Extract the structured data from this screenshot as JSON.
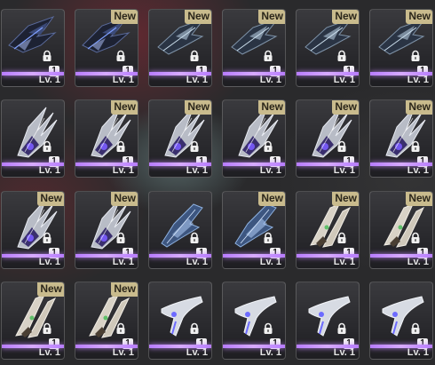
{
  "inventory": {
    "items": [
      {
        "level": "Lv. 1",
        "quantity": "1",
        "is_new": false,
        "new_label": "",
        "icon": "dark-blade-fighter-icon"
      },
      {
        "level": "Lv. 1",
        "quantity": "1",
        "is_new": true,
        "new_label": "New",
        "icon": "dark-blade-fighter-icon"
      },
      {
        "level": "Lv. 1",
        "quantity": "1",
        "is_new": true,
        "new_label": "New",
        "icon": "spike-fighter-icon"
      },
      {
        "level": "Lv. 1",
        "quantity": "1",
        "is_new": true,
        "new_label": "New",
        "icon": "spike-fighter-icon"
      },
      {
        "level": "Lv. 1",
        "quantity": "1",
        "is_new": true,
        "new_label": "New",
        "icon": "spike-fighter-icon"
      },
      {
        "level": "Lv. 1",
        "quantity": "1",
        "is_new": true,
        "new_label": "New",
        "icon": "spike-fighter-icon"
      },
      {
        "level": "Lv. 1",
        "quantity": "1",
        "is_new": false,
        "new_label": "",
        "icon": "silver-fork-fighter-icon"
      },
      {
        "level": "Lv. 1",
        "quantity": "1",
        "is_new": true,
        "new_label": "New",
        "icon": "silver-fork-fighter-icon"
      },
      {
        "level": "Lv. 1",
        "quantity": "1",
        "is_new": true,
        "new_label": "New",
        "icon": "silver-fork-fighter-icon"
      },
      {
        "level": "Lv. 1",
        "quantity": "1",
        "is_new": true,
        "new_label": "New",
        "icon": "silver-fork-fighter-icon"
      },
      {
        "level": "Lv. 1",
        "quantity": "1",
        "is_new": true,
        "new_label": "New",
        "icon": "silver-fork-fighter-icon"
      },
      {
        "level": "Lv. 1",
        "quantity": "1",
        "is_new": true,
        "new_label": "New",
        "icon": "silver-fork-fighter-icon"
      },
      {
        "level": "Lv. 1",
        "quantity": "1",
        "is_new": true,
        "new_label": "New",
        "icon": "silver-fork-fighter-icon"
      },
      {
        "level": "Lv. 1",
        "quantity": "1",
        "is_new": true,
        "new_label": "New",
        "icon": "silver-fork-fighter-icon"
      },
      {
        "level": "Lv. 1",
        "quantity": "1",
        "is_new": false,
        "new_label": "",
        "icon": "blue-wing-fighter-icon"
      },
      {
        "level": "Lv. 1",
        "quantity": "1",
        "is_new": true,
        "new_label": "New",
        "icon": "blue-wing-fighter-icon"
      },
      {
        "level": "Lv. 1",
        "quantity": "1",
        "is_new": true,
        "new_label": "New",
        "icon": "twin-pod-fighter-icon"
      },
      {
        "level": "Lv. 1",
        "quantity": "1",
        "is_new": true,
        "new_label": "New",
        "icon": "twin-pod-fighter-icon"
      },
      {
        "level": "Lv. 1",
        "quantity": "1",
        "is_new": true,
        "new_label": "New",
        "icon": "twin-pod-fighter-icon"
      },
      {
        "level": "Lv. 1",
        "quantity": "1",
        "is_new": true,
        "new_label": "New",
        "icon": "twin-pod-fighter-icon"
      },
      {
        "level": "Lv. 1",
        "quantity": "1",
        "is_new": false,
        "new_label": "",
        "icon": "hook-fighter-icon"
      },
      {
        "level": "Lv. 1",
        "quantity": "1",
        "is_new": false,
        "new_label": "",
        "icon": "hook-fighter-icon"
      },
      {
        "level": "Lv. 1",
        "quantity": "1",
        "is_new": false,
        "new_label": "",
        "icon": "hook-fighter-icon"
      },
      {
        "level": "Lv. 1",
        "quantity": "1",
        "is_new": false,
        "new_label": "",
        "icon": "hook-fighter-icon"
      }
    ],
    "colors": {
      "rarity_bar": "#c58cff",
      "new_badge": "#c9bb8d"
    }
  }
}
